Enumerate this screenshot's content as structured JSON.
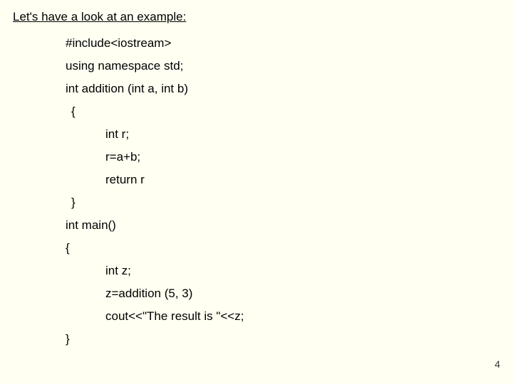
{
  "intro": "Let's have a look at an example:",
  "code": {
    "l1": "#include<iostream>",
    "l2": "using namespace std;",
    "l3": "int addition (int a, int b)",
    "l4": "{",
    "l5": "int r;",
    "l6": "r=a+b;",
    "l7": "return r",
    "l8": "}",
    "l9": "int main()",
    "l10": "{",
    "l11": "int z;",
    "l12": "z=addition (5, 3)",
    "l13": "cout<<\"The result is \"<<z;",
    "l14": "}"
  },
  "page_number": "4"
}
